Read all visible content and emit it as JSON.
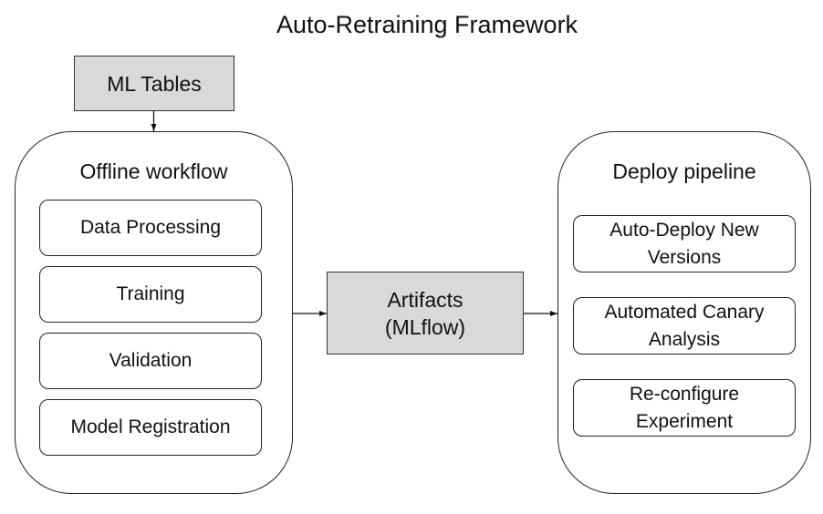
{
  "title": "Auto-Retraining Framework",
  "source": {
    "label": "ML Tables",
    "fill": "#d9d9d9"
  },
  "offline": {
    "title": "Offline workflow",
    "steps": [
      {
        "label": "Data Processing"
      },
      {
        "label": "Training"
      },
      {
        "label": "Validation"
      },
      {
        "label": "Model Registration"
      }
    ]
  },
  "artifacts": {
    "line1": "Artifacts",
    "line2": "(MLflow)",
    "fill": "#d9d9d9"
  },
  "deploy": {
    "title": "Deploy pipeline",
    "steps": [
      {
        "line1": "Auto-Deploy New",
        "line2": "Versions"
      },
      {
        "line1": "Automated Canary",
        "line2": "Analysis"
      },
      {
        "line1": "Re-configure",
        "line2": "Experiment"
      }
    ]
  },
  "edges": [
    {
      "from": "ML Tables",
      "to": "Offline workflow"
    },
    {
      "from": "Offline workflow",
      "to": "Artifacts (MLflow)"
    },
    {
      "from": "Artifacts (MLflow)",
      "to": "Deploy pipeline"
    }
  ]
}
